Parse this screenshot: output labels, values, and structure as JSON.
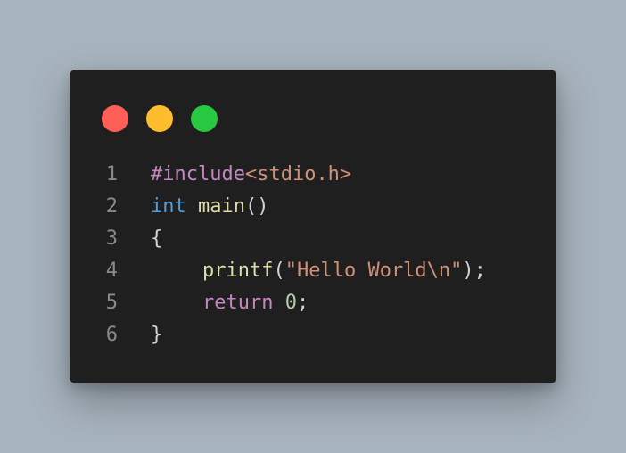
{
  "window": {
    "traffic_lights": [
      {
        "name": "close",
        "color": "#ff5f57"
      },
      {
        "name": "minimize",
        "color": "#febc2e"
      },
      {
        "name": "maximize",
        "color": "#28c840"
      }
    ]
  },
  "colors": {
    "background": "#a7b3bd",
    "editor": "#1f1f1f",
    "line_number": "#8a8a8a",
    "plain": "#d4d4d4",
    "preprocessor": "#c586c0",
    "header": "#ce9178",
    "type_keyword": "#569cd6",
    "function": "#dcdcaa",
    "string": "#ce9178",
    "number": "#b5cea8",
    "control": "#c586c0"
  },
  "code": {
    "lines": [
      {
        "num": "1",
        "tokens": [
          {
            "t": "#include",
            "c": "preprocessor"
          },
          {
            "t": "<stdio.h>",
            "c": "header"
          }
        ]
      },
      {
        "num": "2",
        "tokens": [
          {
            "t": "int",
            "c": "type_keyword"
          },
          {
            "t": " ",
            "c": "plain"
          },
          {
            "t": "main",
            "c": "function"
          },
          {
            "t": "()",
            "c": "plain"
          }
        ]
      },
      {
        "num": "3",
        "tokens": [
          {
            "t": "{",
            "c": "plain"
          }
        ]
      },
      {
        "num": "4",
        "indent": true,
        "tokens": [
          {
            "t": "printf",
            "c": "function"
          },
          {
            "t": "(",
            "c": "plain"
          },
          {
            "t": "\"Hello World\\n\"",
            "c": "string"
          },
          {
            "t": ");",
            "c": "plain"
          }
        ]
      },
      {
        "num": "5",
        "indent": true,
        "tokens": [
          {
            "t": "return",
            "c": "control"
          },
          {
            "t": " ",
            "c": "plain"
          },
          {
            "t": "0",
            "c": "number"
          },
          {
            "t": ";",
            "c": "plain"
          }
        ]
      },
      {
        "num": "6",
        "tokens": [
          {
            "t": "}",
            "c": "plain"
          }
        ]
      }
    ]
  }
}
